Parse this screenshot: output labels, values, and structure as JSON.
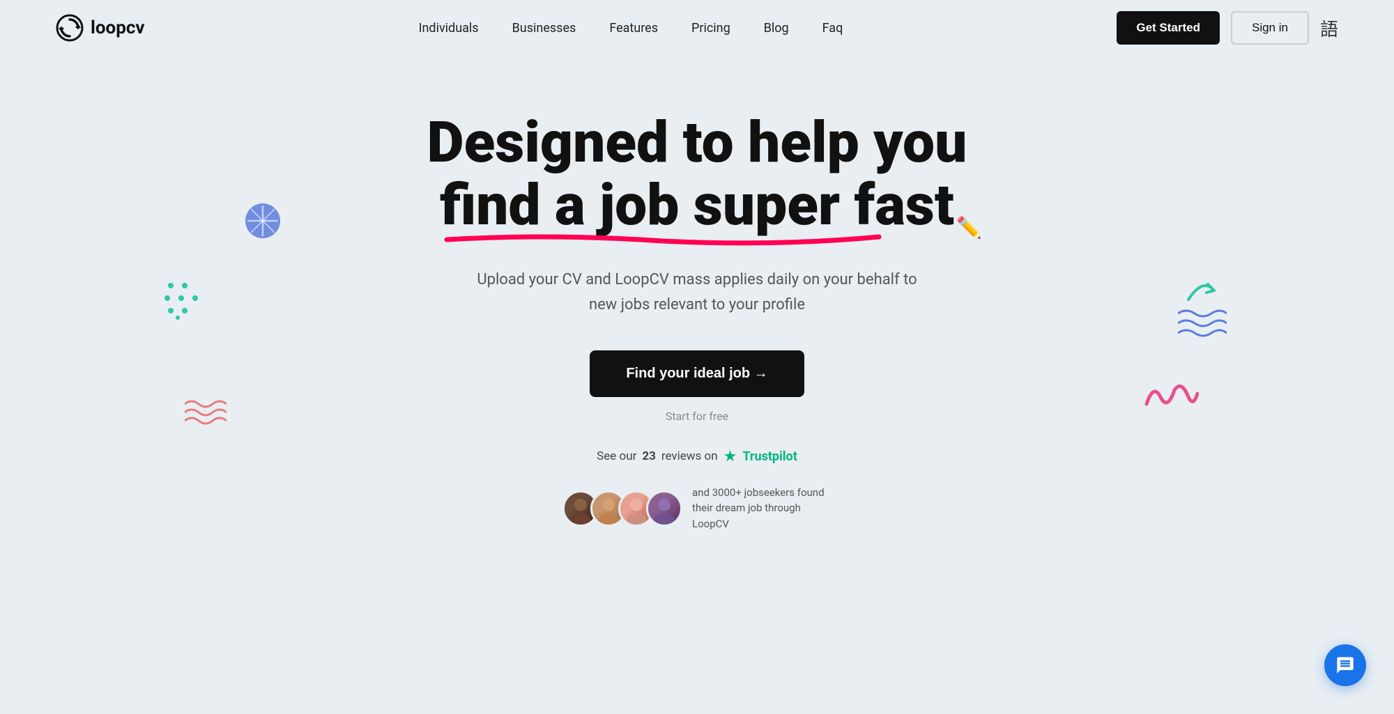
{
  "nav": {
    "logo_text": "loopcv",
    "links": [
      {
        "label": "Individuals",
        "id": "individuals"
      },
      {
        "label": "Businesses",
        "id": "businesses"
      },
      {
        "label": "Features",
        "id": "features"
      },
      {
        "label": "Pricing",
        "id": "pricing"
      },
      {
        "label": "Blog",
        "id": "blog"
      },
      {
        "label": "Faq",
        "id": "faq"
      }
    ],
    "get_started_label": "Get Started",
    "sign_in_label": "Sign in"
  },
  "hero": {
    "title_line1": "Designed to help you",
    "title_line2": "find a job super fast",
    "subtitle": "Upload your CV and LoopCV mass applies daily on your behalf to new jobs relevant to your profile",
    "cta_label": "Find your ideal job →",
    "start_free": "Start for free",
    "trustpilot_text": "See our",
    "trustpilot_count": "23",
    "trustpilot_reviews": "reviews on",
    "trustpilot_brand": "Trustpilot",
    "users_text": "and 3000+ jobseekers found their dream job through LoopCV"
  }
}
